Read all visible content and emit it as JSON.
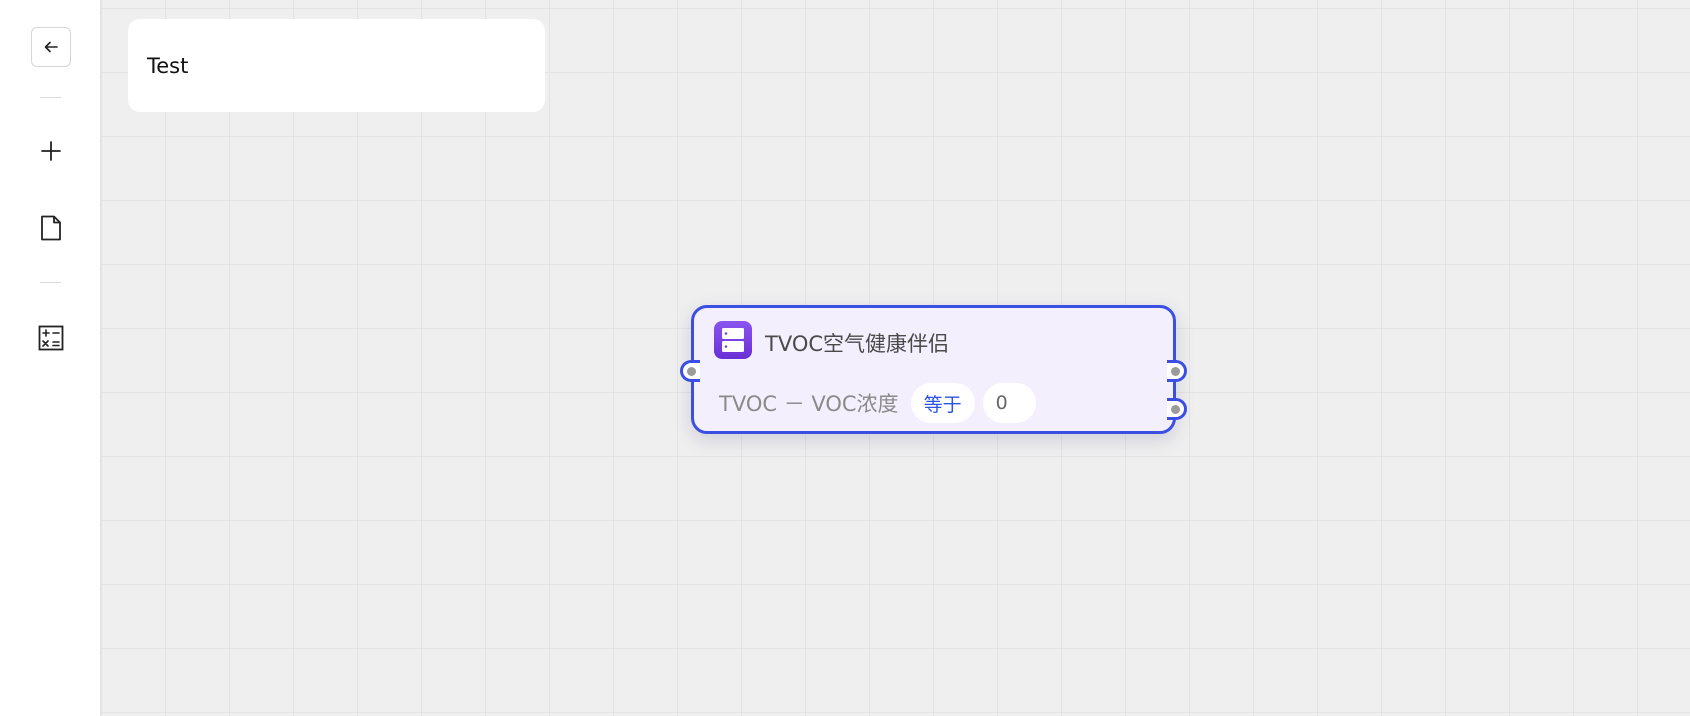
{
  "sidebar": {
    "tools": [
      {
        "name": "back",
        "icon": "arrow-left-icon"
      },
      {
        "name": "add",
        "icon": "plus-icon"
      },
      {
        "name": "document",
        "icon": "document-icon"
      },
      {
        "name": "calculator",
        "icon": "calculator-icon"
      }
    ]
  },
  "canvas": {
    "title": "Test"
  },
  "node": {
    "icon": "device-server-icon",
    "title": "TVOC空气健康伴侣",
    "condition": {
      "label": "TVOC － VOC浓度",
      "operator": "等于",
      "value": "0"
    },
    "colors": {
      "border": "#3b4fe3",
      "background": "#f4effd",
      "operator": "#2b55e0",
      "icon": "#7a40e6"
    }
  }
}
